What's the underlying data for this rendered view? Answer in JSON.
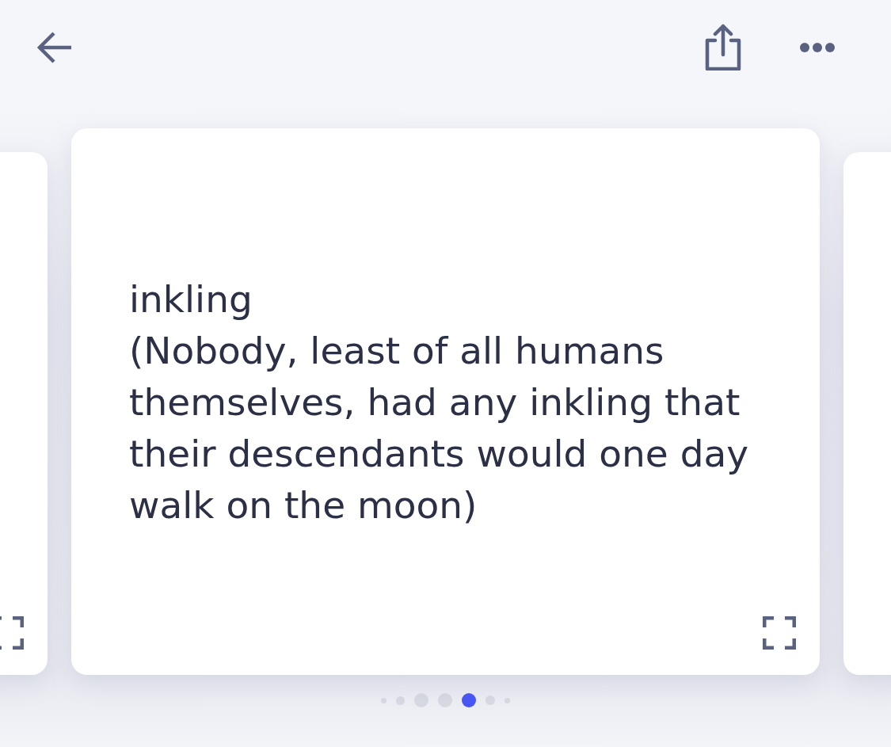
{
  "card": {
    "term": "inkling",
    "example": "(Nobody, least of all humans themselves, had any inkling that their descendants would one day walk on the moon)"
  },
  "pages": [
    {
      "selected": false
    },
    {
      "selected": false
    },
    {
      "selected": false
    },
    {
      "selected": false
    },
    {
      "selected": true
    },
    {
      "selected": false
    },
    {
      "selected": false
    }
  ]
}
